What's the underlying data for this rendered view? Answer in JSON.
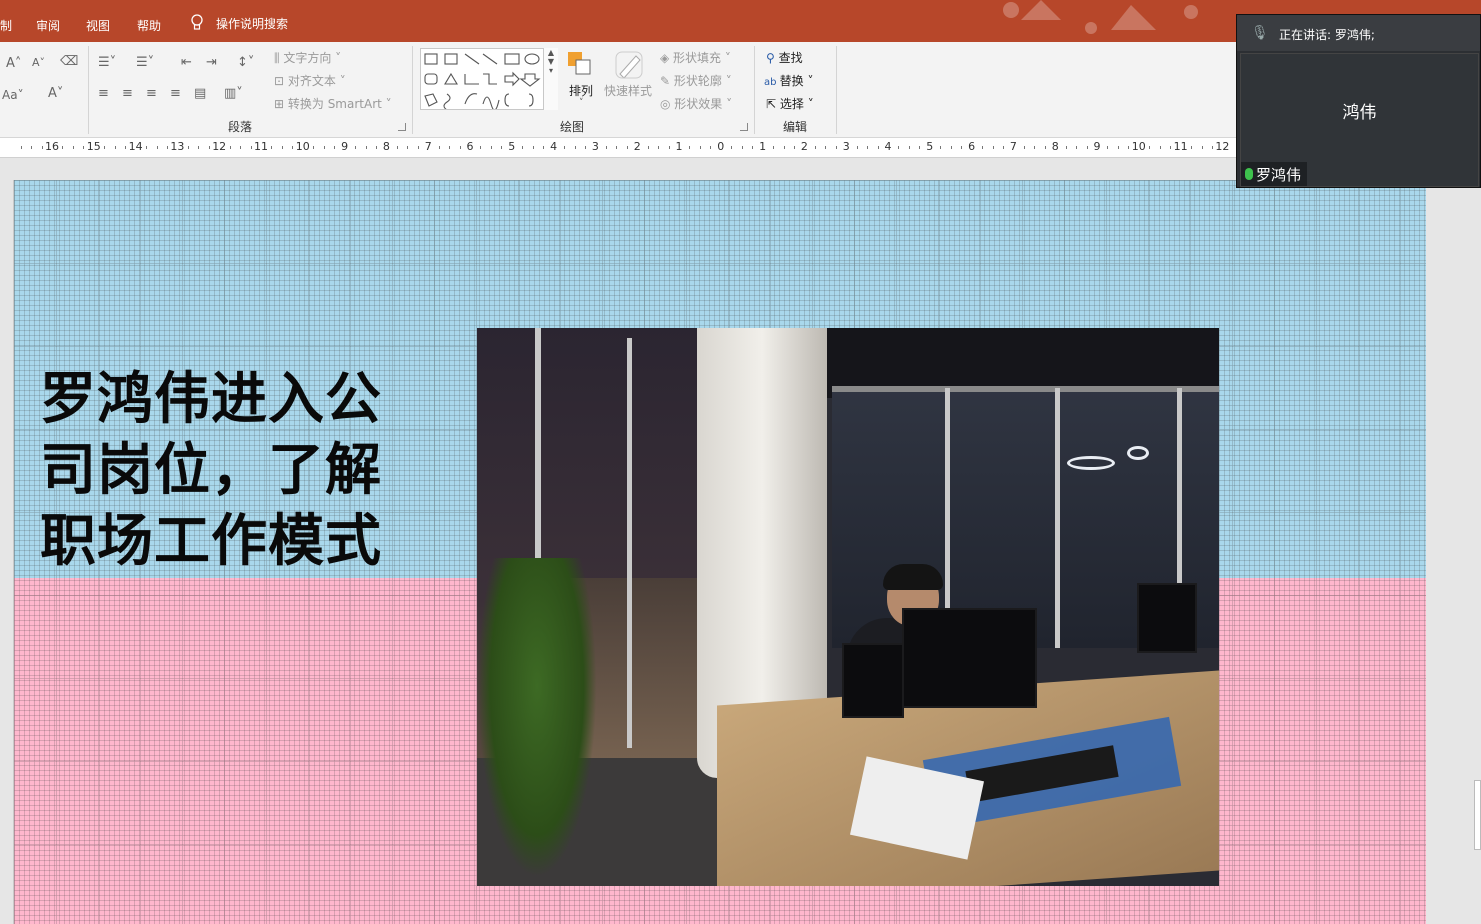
{
  "tabs": [
    {
      "label": "制"
    },
    {
      "label": "审阅"
    },
    {
      "label": "视图"
    },
    {
      "label": "帮助"
    }
  ],
  "tell_me": "操作说明搜索",
  "ribbon": {
    "paragraph": {
      "label": "段落",
      "text_direction": "文字方向",
      "align_text": "对齐文本",
      "convert_smartart": "转换为 SmartArt"
    },
    "drawing": {
      "label": "绘图",
      "arrange": "排列",
      "quick_styles": "快速样式",
      "shape_fill": "形状填充",
      "shape_outline": "形状轮廓",
      "shape_effects": "形状效果"
    },
    "editing": {
      "label": "编辑",
      "find": "查找",
      "replace": "替换",
      "select": "选择"
    }
  },
  "ruler": {
    "labels": [
      "16",
      "15",
      "14",
      "13",
      "12",
      "11",
      "10",
      "9",
      "8",
      "7",
      "6",
      "5",
      "4",
      "3",
      "2",
      "1",
      "0",
      "1",
      "2",
      "3",
      "4",
      "5",
      "6",
      "7",
      "8",
      "9",
      "10",
      "11",
      "12"
    ]
  },
  "slide": {
    "title": "罗鸿伟进入公司岗位，了解职场工作模式",
    "colors": {
      "top": "#a9d8ec",
      "bottom": "#ffb7cd"
    }
  },
  "meeting": {
    "speaking": "正在讲话: 罗鸿伟;",
    "participant_display": "鸿伟",
    "participant_name": "罗鸿伟"
  },
  "theme": {
    "accent": "#b7472a"
  }
}
